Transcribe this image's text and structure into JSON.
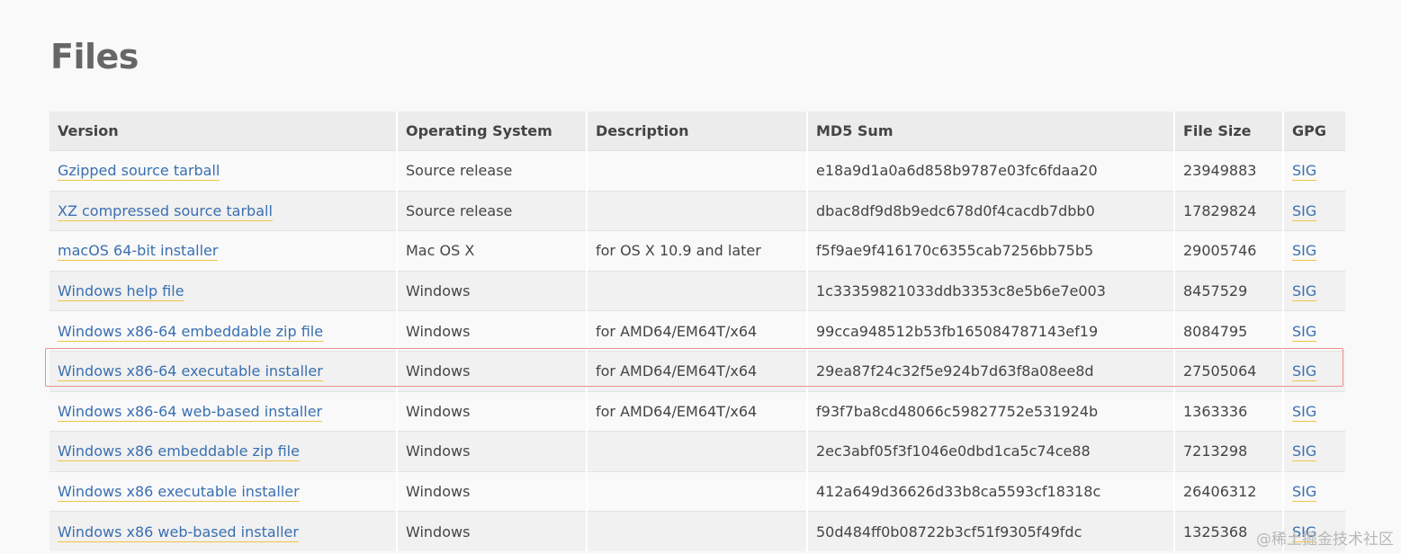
{
  "page": {
    "title": "Files"
  },
  "table": {
    "headers": {
      "version": "Version",
      "os": "Operating System",
      "description": "Description",
      "md5": "MD5 Sum",
      "size": "File Size",
      "gpg": "GPG"
    },
    "rows": [
      {
        "version": "Gzipped source tarball",
        "os": "Source release",
        "description": "",
        "md5": "e18a9d1a0a6d858b9787e03fc6fdaa20",
        "size": "23949883",
        "gpg": "SIG"
      },
      {
        "version": "XZ compressed source tarball",
        "os": "Source release",
        "description": "",
        "md5": "dbac8df9d8b9edc678d0f4cacdb7dbb0",
        "size": "17829824",
        "gpg": "SIG"
      },
      {
        "version": "macOS 64-bit installer",
        "os": "Mac OS X",
        "description": "for OS X 10.9 and later",
        "md5": "f5f9ae9f416170c6355cab7256bb75b5",
        "size": "29005746",
        "gpg": "SIG"
      },
      {
        "version": "Windows help file",
        "os": "Windows",
        "description": "",
        "md5": "1c33359821033ddb3353c8e5b6e7e003",
        "size": "8457529",
        "gpg": "SIG"
      },
      {
        "version": "Windows x86-64 embeddable zip file",
        "os": "Windows",
        "description": "for AMD64/EM64T/x64",
        "md5": "99cca948512b53fb165084787143ef19",
        "size": "8084795",
        "gpg": "SIG"
      },
      {
        "version": "Windows x86-64 executable installer",
        "os": "Windows",
        "description": "for AMD64/EM64T/x64",
        "md5": "29ea87f24c32f5e924b7d63f8a08ee8d",
        "size": "27505064",
        "gpg": "SIG"
      },
      {
        "version": "Windows x86-64 web-based installer",
        "os": "Windows",
        "description": "for AMD64/EM64T/x64",
        "md5": "f93f7ba8cd48066c59827752e531924b",
        "size": "1363336",
        "gpg": "SIG"
      },
      {
        "version": "Windows x86 embeddable zip file",
        "os": "Windows",
        "description": "",
        "md5": "2ec3abf05f3f1046e0dbd1ca5c74ce88",
        "size": "7213298",
        "gpg": "SIG"
      },
      {
        "version": "Windows x86 executable installer",
        "os": "Windows",
        "description": "",
        "md5": "412a649d36626d33b8ca5593cf18318c",
        "size": "26406312",
        "gpg": "SIG"
      },
      {
        "version": "Windows x86 web-based installer",
        "os": "Windows",
        "description": "",
        "md5": "50d484ff0b08722b3cf51f9305f49fdc",
        "size": "1325368",
        "gpg": "SIG"
      }
    ],
    "highlighted_row": "Windows x86-64 executable installer"
  },
  "watermark": {
    "text": "@稀土掘金技术社区"
  },
  "colors": {
    "link": "#3a6fb0",
    "link_underline": "#f0c542",
    "highlight_border": "#e8908c",
    "header_bg": "#ececec",
    "row_alt_bg": "#f1f1f1"
  }
}
